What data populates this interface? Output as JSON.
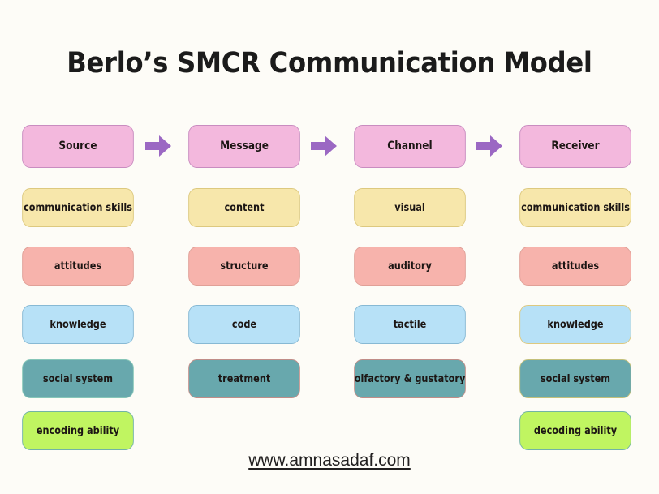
{
  "title": "Berlo’s SMCR Communication Model",
  "footer": {
    "url": "www.amnasadaf.com"
  },
  "colors": {
    "background": "#fdfcf7",
    "arrow": "#9b68c3",
    "header_fill": "#f3b8dd",
    "header_border": "#c98cc0",
    "yellow_fill": "#f7e7ab",
    "yellow_border": "#ddc97f",
    "salmon_fill": "#f7b3ac",
    "salmon_border": "#e0a097",
    "blue_fill": "#b7e1f7",
    "blue_border": "#87b9d4",
    "teal_fill": "#68a8ad",
    "teal_border_light": "#86c6b8",
    "teal_border_rose": "#c08d88",
    "teal_border_olive": "#c3c07a",
    "green_fill": "#c0f561",
    "green_border": "#72b3a6",
    "text": "#1c1614"
  },
  "columns": [
    {
      "key": "source",
      "header": "Source",
      "items": [
        "communication skills",
        "attitudes",
        "knowledge",
        "social system",
        "encoding ability"
      ]
    },
    {
      "key": "message",
      "header": "Message",
      "items": [
        "content",
        "structure",
        "code",
        "treatment"
      ]
    },
    {
      "key": "channel",
      "header": "Channel",
      "items": [
        "visual",
        "auditory",
        "tactile",
        "olfactory & gustatory"
      ]
    },
    {
      "key": "receiver",
      "header": "Receiver",
      "items": [
        "communication skills",
        "attitudes",
        "knowledge",
        "social system",
        "decoding ability"
      ]
    }
  ],
  "arrows": [
    {
      "name": "arrow-source-to-message",
      "glyph": "right-arrow"
    },
    {
      "name": "arrow-message-to-channel",
      "glyph": "right-arrow"
    },
    {
      "name": "arrow-channel-to-receiver",
      "glyph": "right-arrow"
    }
  ]
}
